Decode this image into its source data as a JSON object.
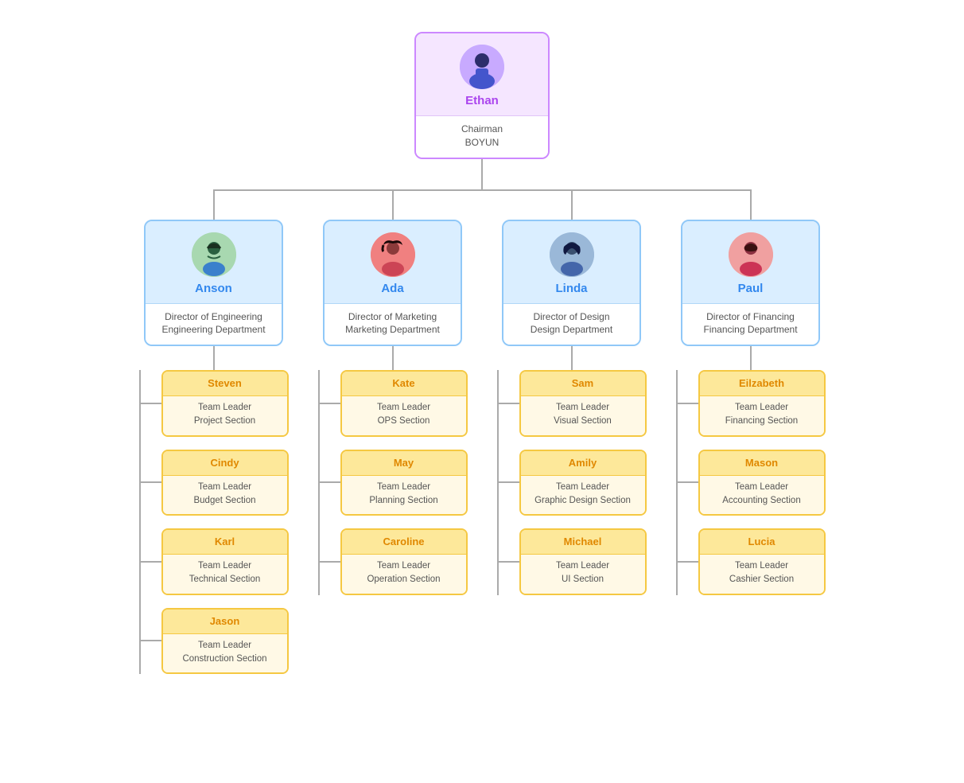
{
  "chairman": {
    "name": "Ethan",
    "title": "Chairman",
    "org": "BOYUN"
  },
  "directors": [
    {
      "name": "Anson",
      "title": "Director of Engineering",
      "dept": "Engineering Department",
      "avatarColor": "#a8d8b0",
      "avatarEmoji": "👨‍💼"
    },
    {
      "name": "Ada",
      "title": "Director of Marketing",
      "dept": "Marketing Department",
      "avatarColor": "#f08080",
      "avatarEmoji": "👩‍💼"
    },
    {
      "name": "Linda",
      "title": "Director of Design",
      "dept": "Design Department",
      "avatarColor": "#9ab8d8",
      "avatarEmoji": "👩‍💼"
    },
    {
      "name": "Paul",
      "title": "Director of Financing",
      "dept": "Financing Department",
      "avatarColor": "#f0a0a0",
      "avatarEmoji": "👨‍💼"
    }
  ],
  "leaders": {
    "anson": [
      {
        "name": "Steven",
        "role": "Team Leader",
        "section": "Project Section"
      },
      {
        "name": "Cindy",
        "role": "Team Leader",
        "section": "Budget Section"
      },
      {
        "name": "Karl",
        "role": "Team Leader",
        "section": "Technical Section"
      },
      {
        "name": "Jason",
        "role": "Team Leader",
        "section": "Construction Section"
      }
    ],
    "ada": [
      {
        "name": "Kate",
        "role": "Team Leader",
        "section": "OPS Section"
      },
      {
        "name": "May",
        "role": "Team Leader",
        "section": "Planning Section"
      },
      {
        "name": "Caroline",
        "role": "Team Leader",
        "section": "Operation Section"
      }
    ],
    "linda": [
      {
        "name": "Sam",
        "role": "Team Leader",
        "section": "Visual Section"
      },
      {
        "name": "Amily",
        "role": "Team Leader",
        "section": "Graphic Design Section"
      },
      {
        "name": "Michael",
        "role": "Team Leader",
        "section": "UI Section"
      }
    ],
    "paul": [
      {
        "name": "Eilzabeth",
        "role": "Team Leader",
        "section": "Financing Section"
      },
      {
        "name": "Mason",
        "role": "Team Leader",
        "section": "Accounting Section"
      },
      {
        "name": "Lucia",
        "role": "Team Leader",
        "section": "Cashier Section"
      }
    ]
  }
}
